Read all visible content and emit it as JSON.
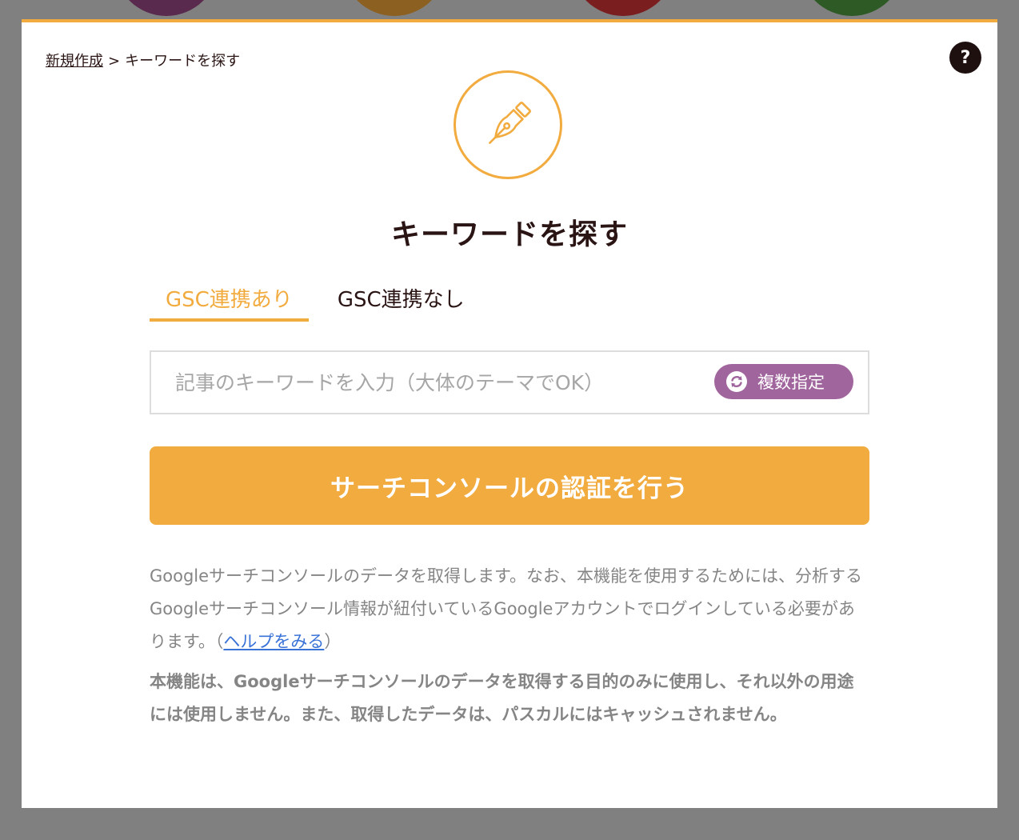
{
  "colors": {
    "accent": "#f2ab3e",
    "purple_button": "#a1659e",
    "text_dark": "#2a1414",
    "text_gray": "#858585",
    "link": "#3a73d8",
    "overlay": "#808080",
    "bg_circles": [
      "#5a2a4e",
      "#8b6020",
      "#7a1e20",
      "#2e5a26"
    ]
  },
  "breadcrumb": {
    "parent": "新規作成",
    "separator": ">",
    "current": "キーワードを探す"
  },
  "help": {
    "icon": "question-icon",
    "label": "?"
  },
  "header": {
    "icon": "pen-nib-icon",
    "title": "キーワードを探す"
  },
  "tabs": [
    {
      "label": "GSC連携あり",
      "active": true
    },
    {
      "label": "GSC連携なし",
      "active": false
    }
  ],
  "keyword_input": {
    "value": "",
    "placeholder": "記事のキーワードを入力（大体のテーマでOK）"
  },
  "multi_button": {
    "icon": "sync-icon",
    "label": "複数指定"
  },
  "auth_button": {
    "label": "サーチコンソールの認証を行う"
  },
  "description": {
    "text": "Googleサーチコンソールのデータを取得します。なお、本機能を使用するためには、分析するGoogleサーチコンソール情報が紐付いているGoogleアカウントでログインしている必要があります。（",
    "link": "ヘルプをみる",
    "after": "）"
  },
  "note": {
    "text": "本機能は、Googleサーチコンソールのデータを取得する目的のみに使用し、それ以外の用途には使用しません。また、取得したデータは、パスカルにはキャッシュされません。"
  }
}
